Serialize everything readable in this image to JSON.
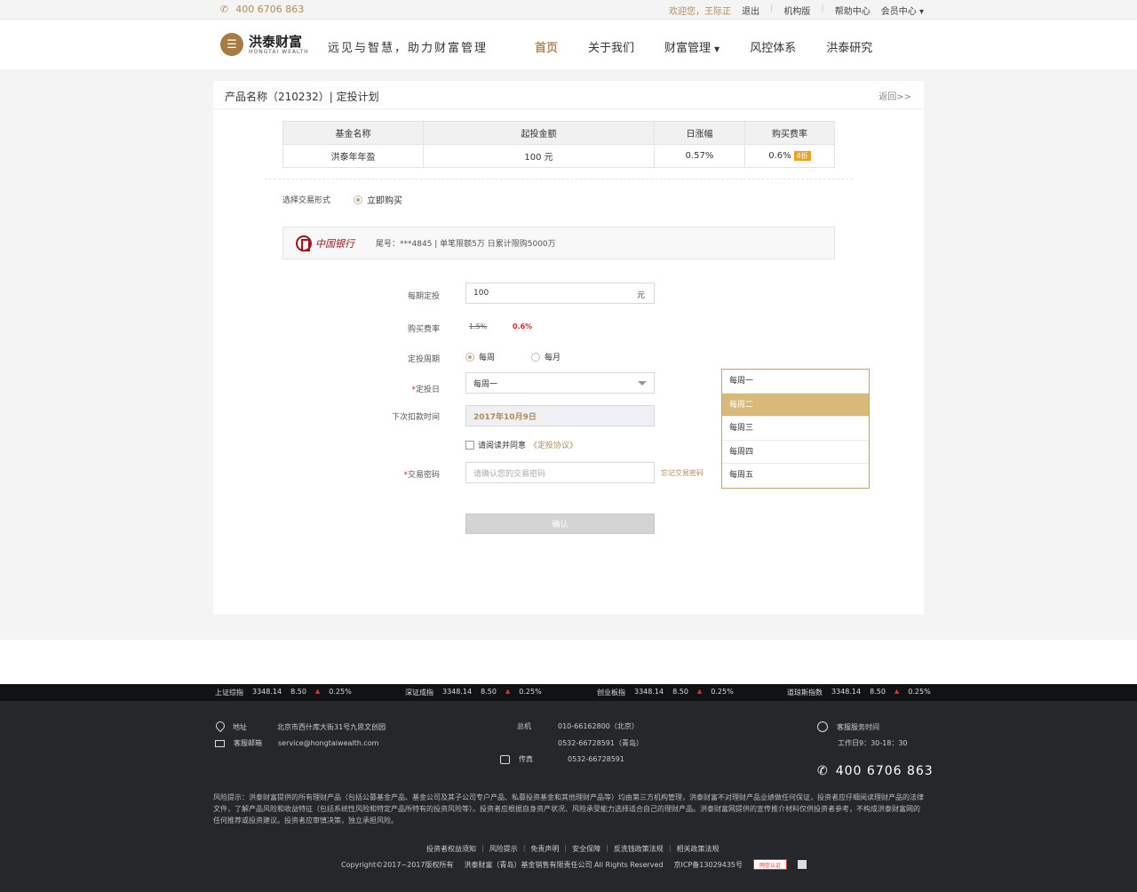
{
  "topbar": {
    "phone": "400 6706 863",
    "welcome": "欢迎您，王际正",
    "logout": "退出",
    "institution": "机构版",
    "help": "帮助中心",
    "member": "会员中心"
  },
  "header": {
    "logo_cn": "洪泰财富",
    "logo_en": "HONGTAI WEALTH",
    "slogan": "远见与智慧，助力财富管理",
    "nav": [
      {
        "label": "首页",
        "active": true
      },
      {
        "label": "关于我们"
      },
      {
        "label": "财富管理"
      },
      {
        "label": "风控体系"
      },
      {
        "label": "洪泰研究"
      }
    ]
  },
  "card": {
    "title": "产品名称（210232）| 定投计划",
    "back": "返回>>"
  },
  "product_table": {
    "headers": [
      "基金名称",
      "起投金额",
      "日涨幅",
      "购买费率"
    ],
    "row": {
      "name": "洪泰年年盈",
      "min": "100 元",
      "change": "0.57%",
      "fee": "0.6%",
      "discount": "4折"
    }
  },
  "trade_mode": {
    "label": "选择交易形式",
    "option": "立即购买"
  },
  "bank": {
    "name": "中国银行",
    "info": "尾号：***4845 | 单笔限额5万 日累计限购5000万"
  },
  "form": {
    "amount_label": "每期定投",
    "amount_value": "100",
    "amount_unit": "元",
    "fee_label": "购买费率",
    "fee_old": "1.5%",
    "fee_new": "0.6%",
    "period_label": "定投周期",
    "period_weekly": "每周",
    "period_monthly": "每月",
    "day_label": "定投日",
    "day_value": "每周一",
    "next_label": "下次扣款时间",
    "next_value": "2017年10月9日",
    "agree_text": "请阅读并同意",
    "agree_link": "《定投协议》",
    "pwd_label": "交易密码",
    "pwd_placeholder": "请确认您的交易密码",
    "forgot": "忘记交易密码",
    "confirm": "确认"
  },
  "dropdown": [
    "每周一",
    "每周二",
    "每周三",
    "每周四",
    "每周五"
  ],
  "footer": {
    "ticker": [
      {
        "name": "上证综指",
        "value": "3348.14",
        "change": "8.50",
        "pct": "0.25%"
      },
      {
        "name": "深证成指",
        "value": "3348.14",
        "change": "8.50",
        "pct": "0.25%"
      },
      {
        "name": "创业板指",
        "value": "3348.14",
        "change": "8.50",
        "pct": "0.25%"
      },
      {
        "name": "道琼斯指数",
        "value": "3348.14",
        "change": "8.50",
        "pct": "0.25%"
      }
    ],
    "address_label": "地址",
    "address": "北京市西什库大街31号九思文创园",
    "email_label": "客服邮箱",
    "email": "service@hongtaiwealth.com",
    "switch_label": "总机",
    "switch_bj": "010-66162800（北京）",
    "switch_qd": "0532-66728591（青岛）",
    "fax_label": "传真",
    "fax": "0532-66728591",
    "service_label": "客服服务时间",
    "service_hours": "工作日9：30-18：30",
    "hotline": "400 6706 863",
    "risk": "风险提示：洪泰财富提供的所有理财产品（包括公募基金产品、基金公司及其子公司专户产品、私募投资基金和其他理财产品等）均由第三方机构管理，洪泰财富不对理财产品业绩做任何保证，投资者应仔细阅读理财产品的法律文件，了解产品风险和收益特征（包括系统性风险和特定产品所特有的投资风险等）。投资者应根据自身资产状况、风险承受能力选择适合自己的理财产品。洪泰财富网提供的宣传推介材料仅供投资者参考，不构成洪泰财富网的任何推荐或投资建议。投资者应审慎决策，独立承担风险。",
    "links": [
      "投资者权益须知",
      "风险提示",
      "免责声明",
      "安全保障",
      "反洗钱政策法规",
      "相关政策法规"
    ],
    "copyright": "Copyright©2017~2017版权所有",
    "company": "洪泰财富（青岛）基金销售有限责任公司 All Rights Reserved",
    "icp": "京ICP备13029435号",
    "badge": "网信认证"
  }
}
